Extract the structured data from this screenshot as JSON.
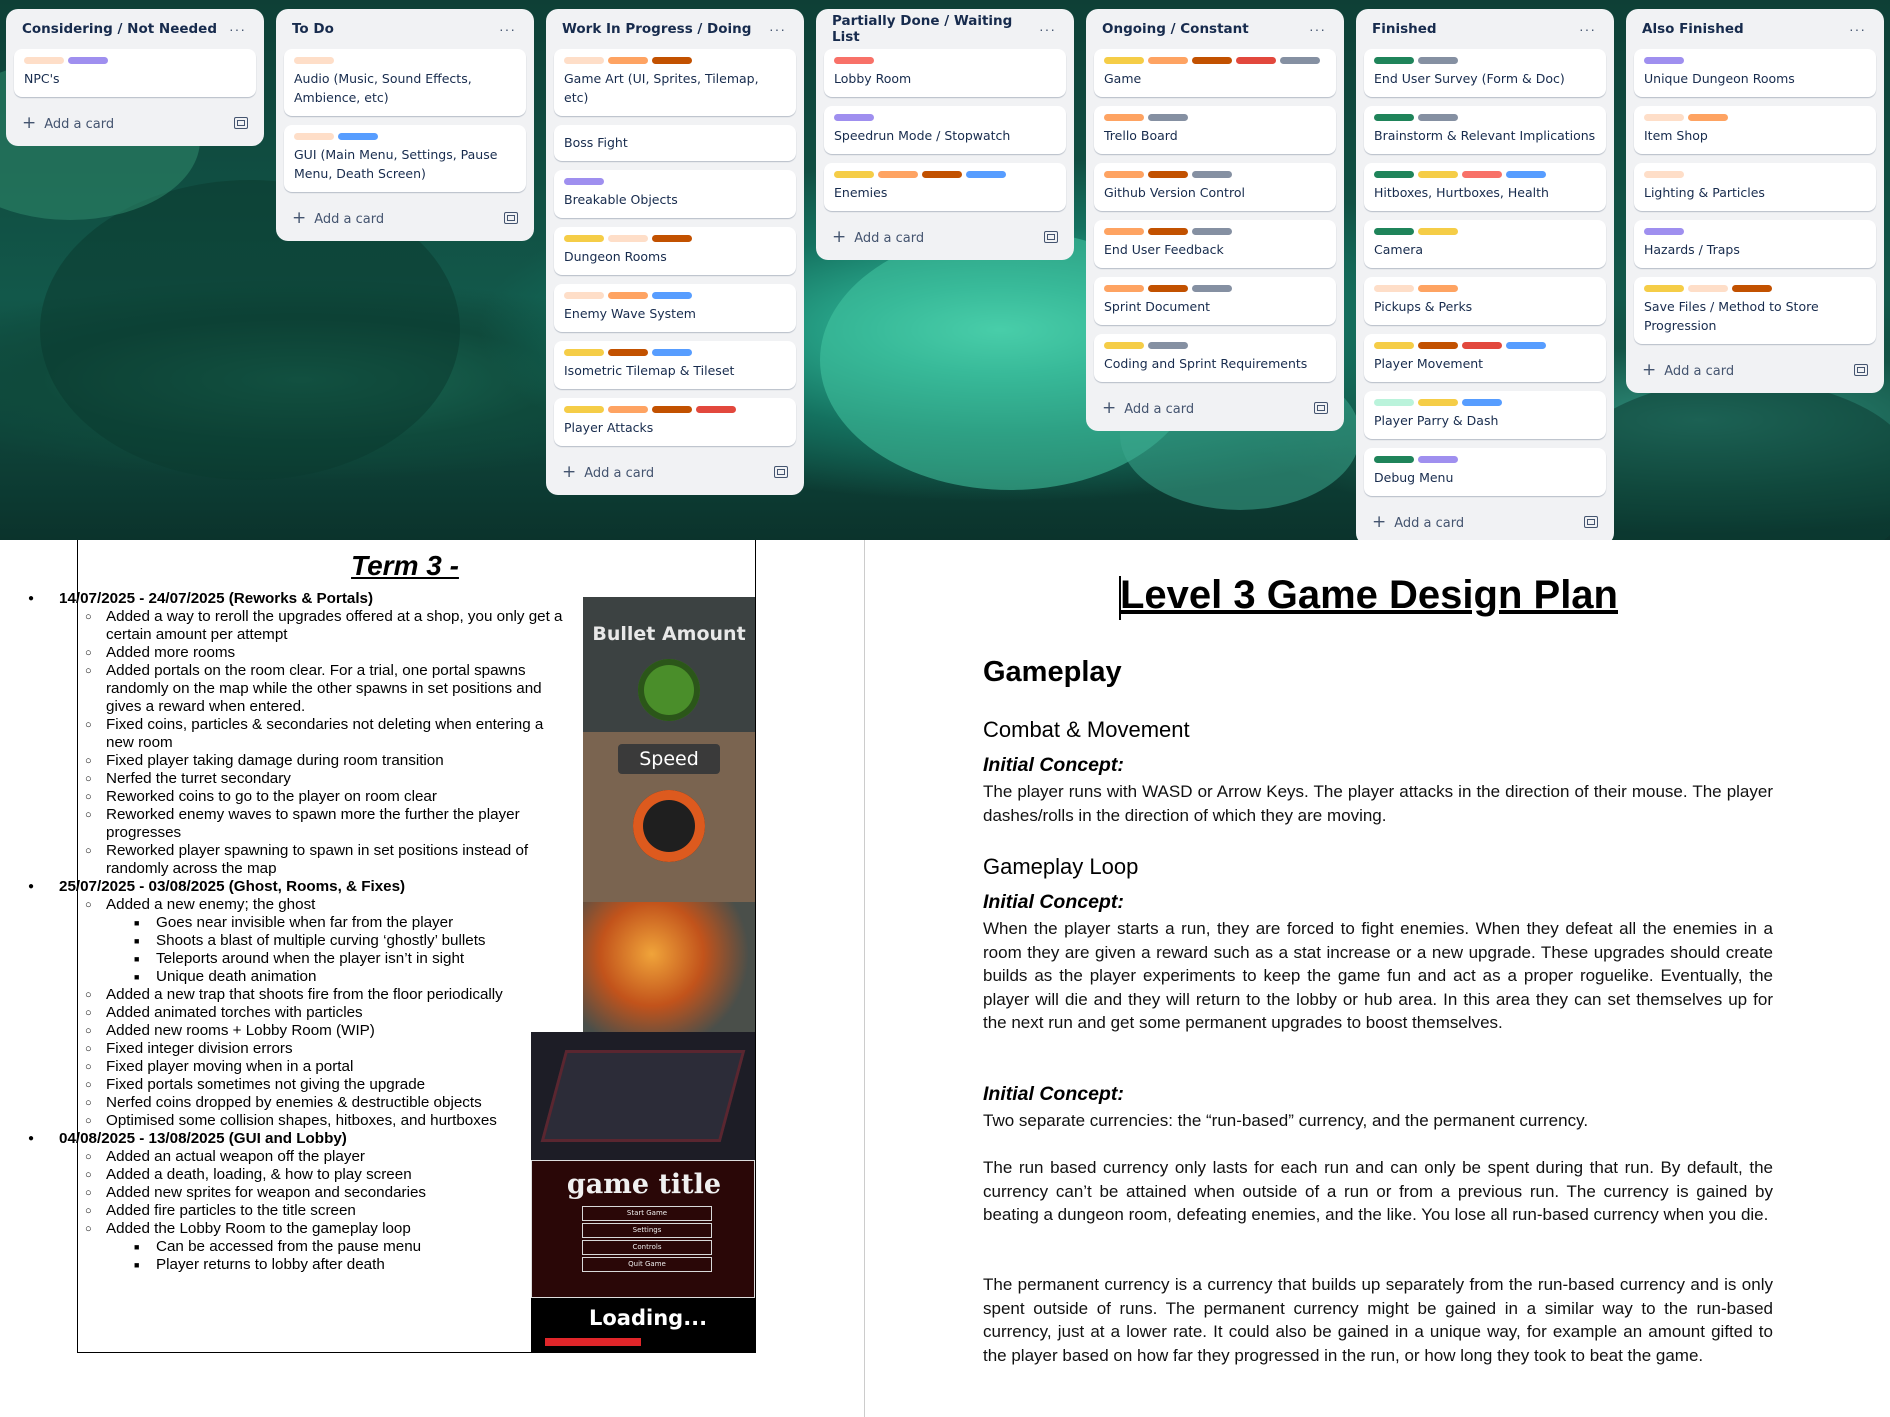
{
  "colors": {
    "green": "#1f845a",
    "gray": "#8590a2",
    "yellow": "#f5cd47",
    "orange": "#fea362",
    "dark_orange": "#c25100",
    "red": "#e2483d",
    "salmon": "#f87168",
    "peach": "#fedec8",
    "purple": "#9f8fef",
    "blue": "#579dff",
    "mint": "#baf3db"
  },
  "board": {
    "add_card_label": "Add a card",
    "lists": [
      {
        "title": "Considering / Not Needed",
        "cards": [
          {
            "labels": [
              "peach",
              "purple"
            ],
            "text": "NPC's"
          }
        ]
      },
      {
        "title": "To Do",
        "cards": [
          {
            "labels": [
              "peach"
            ],
            "text": "Audio (Music, Sound Effects, Ambience, etc)"
          },
          {
            "labels": [
              "peach",
              "blue"
            ],
            "text": "GUI (Main Menu, Settings, Pause Menu, Death Screen)"
          }
        ]
      },
      {
        "title": "Work In Progress / Doing",
        "cards": [
          {
            "labels": [
              "peach",
              "orange",
              "dark_orange"
            ],
            "text": "Game Art (UI, Sprites, Tilemap, etc)"
          },
          {
            "labels": [],
            "text": "Boss Fight"
          },
          {
            "labels": [
              "purple"
            ],
            "text": "Breakable Objects"
          },
          {
            "labels": [
              "yellow",
              "peach",
              "dark_orange"
            ],
            "text": "Dungeon Rooms"
          },
          {
            "labels": [
              "peach",
              "orange",
              "blue"
            ],
            "text": "Enemy Wave System"
          },
          {
            "labels": [
              "yellow",
              "dark_orange",
              "blue"
            ],
            "text": "Isometric Tilemap & Tileset"
          },
          {
            "labels": [
              "yellow",
              "orange",
              "dark_orange",
              "red"
            ],
            "text": "Player Attacks"
          }
        ]
      },
      {
        "title": "Partially Done / Waiting List",
        "cards": [
          {
            "labels": [
              "salmon"
            ],
            "text": "Lobby Room"
          },
          {
            "labels": [
              "purple"
            ],
            "text": "Speedrun Mode / Stopwatch"
          },
          {
            "labels": [
              "yellow",
              "orange",
              "dark_orange",
              "blue"
            ],
            "text": "Enemies"
          }
        ]
      },
      {
        "title": "Ongoing / Constant",
        "cards": [
          {
            "labels": [
              "yellow",
              "orange",
              "dark_orange",
              "red",
              "gray"
            ],
            "text": "Game"
          },
          {
            "labels": [
              "orange",
              "gray"
            ],
            "text": "Trello Board"
          },
          {
            "labels": [
              "orange",
              "dark_orange",
              "gray"
            ],
            "text": "Github Version Control"
          },
          {
            "labels": [
              "orange",
              "dark_orange",
              "gray"
            ],
            "text": "End User Feedback"
          },
          {
            "labels": [
              "orange",
              "dark_orange",
              "gray"
            ],
            "text": "Sprint Document"
          },
          {
            "labels": [
              "yellow",
              "gray"
            ],
            "text": "Coding and Sprint Requirements"
          }
        ]
      },
      {
        "title": "Finished",
        "cards": [
          {
            "labels": [
              "green",
              "gray"
            ],
            "text": "End User Survey (Form & Doc)"
          },
          {
            "labels": [
              "green",
              "gray"
            ],
            "text": "Brainstorm & Relevant Implications"
          },
          {
            "labels": [
              "green",
              "yellow",
              "salmon",
              "blue"
            ],
            "text": "Hitboxes, Hurtboxes, Health"
          },
          {
            "labels": [
              "green",
              "yellow"
            ],
            "text": "Camera"
          },
          {
            "labels": [
              "peach",
              "orange"
            ],
            "text": "Pickups & Perks"
          },
          {
            "labels": [
              "yellow",
              "dark_orange",
              "red",
              "blue"
            ],
            "text": "Player Movement"
          },
          {
            "labels": [
              "mint",
              "yellow",
              "blue"
            ],
            "text": "Player Parry & Dash"
          },
          {
            "labels": [
              "green",
              "purple"
            ],
            "text": "Debug Menu"
          }
        ]
      },
      {
        "title": "Also Finished",
        "cards": [
          {
            "labels": [
              "purple"
            ],
            "text": "Unique Dungeon Rooms"
          },
          {
            "labels": [
              "peach",
              "orange"
            ],
            "text": "Item Shop"
          },
          {
            "labels": [
              "peach"
            ],
            "text": "Lighting & Particles"
          },
          {
            "labels": [
              "purple"
            ],
            "text": "Hazards / Traps"
          },
          {
            "labels": [
              "yellow",
              "peach",
              "dark_orange"
            ],
            "text": "Save Files / Method to Store Progression"
          }
        ]
      }
    ]
  },
  "term": {
    "title": "Term 3 -",
    "items": [
      {
        "level": 1,
        "text": "14/07/2025 - 24/07/2025 (Reworks & Portals)"
      },
      {
        "level": 2,
        "text": "Added a way to reroll the upgrades offered at a shop, you only get a certain amount per attempt"
      },
      {
        "level": 2,
        "text": "Added more rooms"
      },
      {
        "level": 2,
        "text": "Added portals on the room clear. For a trial, one portal spawns randomly on the map while the other spawns in set positions and gives a reward when entered."
      },
      {
        "level": 2,
        "text": "Fixed coins, particles & secondaries not deleting when entering a new room"
      },
      {
        "level": 2,
        "text": "Fixed player taking damage during room transition"
      },
      {
        "level": 2,
        "text": "Nerfed the turret secondary"
      },
      {
        "level": 2,
        "text": "Reworked coins to go to the player on room clear"
      },
      {
        "level": 2,
        "text": "Reworked enemy waves to spawn more the further the player progresses"
      },
      {
        "level": 2,
        "text": "Reworked player spawning to spawn in set positions instead of randomly across the map"
      },
      {
        "level": 1,
        "text": "25/07/2025 - 03/08/2025 (Ghost, Rooms, & Fixes)"
      },
      {
        "level": 2,
        "text": "Added a new enemy; the ghost"
      },
      {
        "level": 3,
        "text": "Goes near invisible when far from the player"
      },
      {
        "level": 3,
        "text": "Shoots a blast of multiple curving ‘ghostly’ bullets"
      },
      {
        "level": 3,
        "text": "Teleports around when the player isn’t in sight"
      },
      {
        "level": 3,
        "text": "Unique death animation"
      },
      {
        "level": 2,
        "text": "Added a new trap that shoots fire from the floor periodically"
      },
      {
        "level": 2,
        "text": "Added animated torches with particles"
      },
      {
        "level": 2,
        "text": "Added new rooms + Lobby Room (WIP)"
      },
      {
        "level": 2,
        "text": "Fixed integer division errors"
      },
      {
        "level": 2,
        "text": "Fixed player moving when in a portal"
      },
      {
        "level": 2,
        "text": "Fixed portals sometimes not giving the upgrade"
      },
      {
        "level": 2,
        "text": "Nerfed coins dropped by enemies & destructible objects"
      },
      {
        "level": 2,
        "text": "Optimised some collision shapes, hitboxes, and hurtboxes"
      },
      {
        "level": 1,
        "text": "04/08/2025 - 13/08/2025 (GUI and Lobby)"
      },
      {
        "level": 2,
        "text": "Added an actual weapon off the player"
      },
      {
        "level": 2,
        "text": "Added a death, loading, & how to play screen"
      },
      {
        "level": 2,
        "text": "Added new sprites for weapon and secondaries"
      },
      {
        "level": 2,
        "text": "Added fire particles to the title screen"
      },
      {
        "level": 2,
        "text": "Added the Lobby Room to the gameplay loop"
      },
      {
        "level": 3,
        "text": "Can be accessed from the pause menu"
      },
      {
        "level": 3,
        "text": "Player returns to lobby after death"
      }
    ],
    "shots": {
      "bullet_amount": "Bullet Amount",
      "speed": "Speed",
      "game_title": "game title",
      "menu_buttons": [
        "Start Game",
        "Settings",
        "Controls",
        "Quit Game"
      ],
      "loading": "Loading..."
    }
  },
  "plan": {
    "title": "Level 3 Game Design Plan",
    "gameplay": "Gameplay",
    "combat_heading": "Combat & Movement",
    "initial_concept": "Initial Concept:",
    "combat_text": "The player runs with WASD or Arrow Keys. The player attacks in the direction of their mouse. The player dashes/rolls in the direction of which they are moving.",
    "loop_heading": "Gameplay Loop",
    "loop_text": "When the player starts a run, they are forced to fight enemies. When they defeat all the enemies in a room they are given a reward such as a stat increase or a new upgrade. These upgrades should create builds as the player experiments to keep the game fun and act as a proper roguelike. Eventually, the player will die and they will return to the lobby or hub area. In this area they can set themselves up for the next run and get some permanent upgrades to boost themselves.",
    "currency_text": "Two separate currencies: the “run-based” currency, and the permanent currency.",
    "run_text": "The run based currency only lasts for each run and can only be spent during that run. By default, the currency can’t be attained when outside of a run or from a previous run. The currency is gained by beating a dungeon room, defeating enemies, and the like. You lose all run-based currency when you die.",
    "perm_text": "The permanent currency is a currency that builds up separately from the run-based currency and is only spent outside of runs. The permanent currency might be gained in a similar way to the run-based currency, just at a lower rate. It could also be gained in a unique way, for example an amount gifted to the player based on how far they progressed in the run, or how long they took to beat the game."
  }
}
